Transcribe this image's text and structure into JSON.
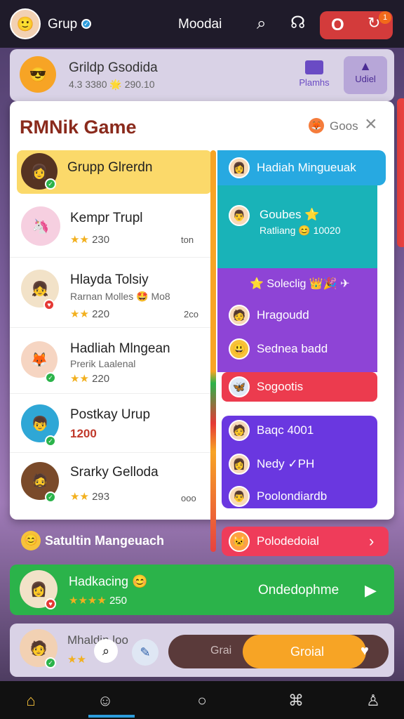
{
  "header": {
    "title": "Grup",
    "center": "Moodai",
    "badge_count": "1",
    "btn_text": "O"
  },
  "group": {
    "name": "Grildp Gsodida",
    "stats": "4.3 3380 🌟 290.10",
    "btn1": "Plamhs",
    "btn2": "Udiel"
  },
  "modal": {
    "title": "RMNik Game",
    "coin_label": "Goos",
    "close": "×"
  },
  "rows": [
    {
      "name": "Grupp Glrerdn",
      "sub": "",
      "stat": ""
    },
    {
      "name": "Kempr Trupl",
      "sub": "",
      "stat": "230",
      "right": "ton"
    },
    {
      "name": "Hlayda Tolsiy",
      "sub": "Rarnan Molles 🤩 Mo8",
      "stat": "220",
      "right": "2co"
    },
    {
      "name": "Hadliah Mlngean",
      "sub": "Prerik Laalenal",
      "stat": "220"
    },
    {
      "name": "Postkay Urup",
      "sub": "",
      "stat": "1200"
    },
    {
      "name": "Srarky Gelloda",
      "sub": "",
      "stat": "293",
      "right": "ooo"
    }
  ],
  "right": {
    "blue_title": "Hadiah Mingueuak",
    "teal_title": "Goubes ⭐",
    "teal_sub": "Ratliang 😊 10020",
    "purple_title": "⭐ Soleclig 👑🎉 ✈",
    "purple_items": [
      "Hragoudd",
      "Sednea badd"
    ],
    "red_label": "Sogootis",
    "violet_items": [
      "Baqc 4001",
      "Nedy ✓PH",
      "Poolondiardb"
    ],
    "pink_label": "Polodedoial"
  },
  "banner": "Satultin Mangeuach",
  "green_card": {
    "name": "Hadkacing 😊",
    "stat": "250",
    "action": "Ondedophme"
  },
  "bottom_card": {
    "name": "Mhaldin loo",
    "tabs": "Grai",
    "cta": "Groial"
  },
  "nav": [
    "home-icon",
    "profile-icon",
    "circle-icon",
    "camera-icon",
    "user-icon"
  ],
  "colors": {
    "accent": "#e8423f",
    "teal": "#19b3b8",
    "purple": "#8e44d6",
    "green": "#2bb34a",
    "orange": "#f7a425"
  }
}
